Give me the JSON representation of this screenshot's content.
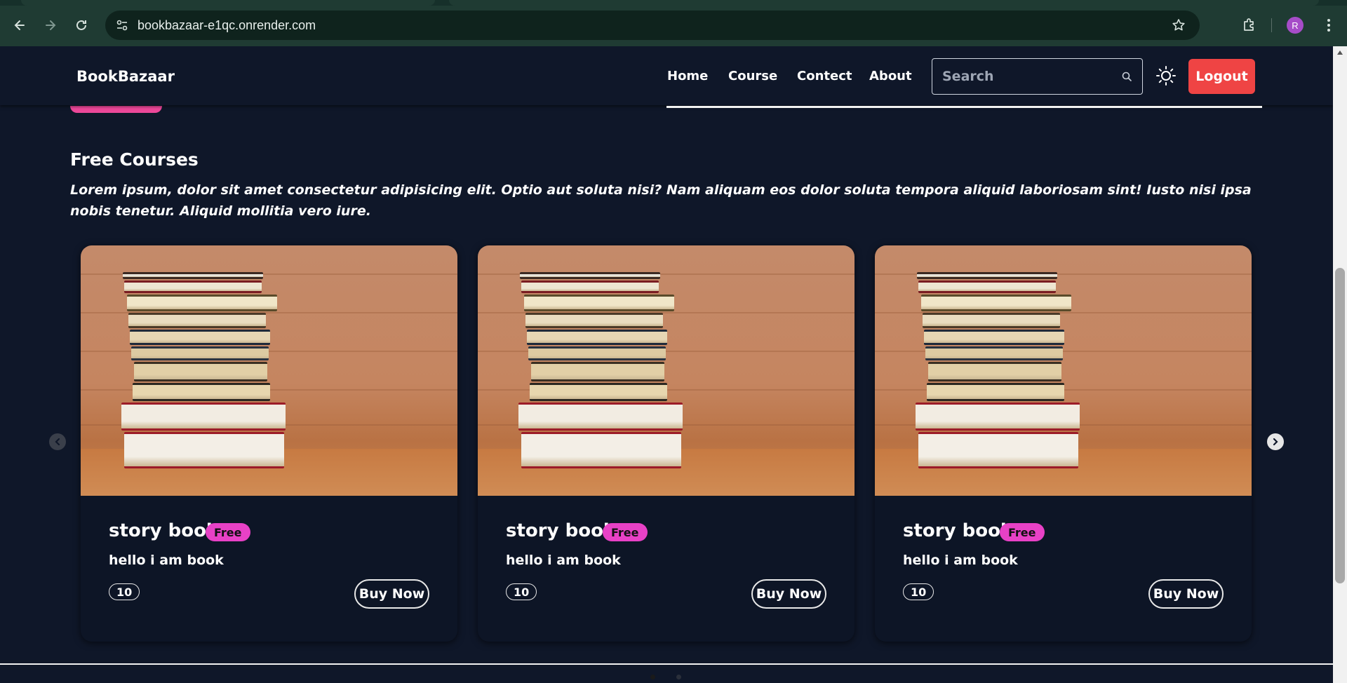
{
  "browser": {
    "url": "bookbazaar-e1qc.onrender.com",
    "profile_initial": "R",
    "icons": [
      "back-icon",
      "forward-icon",
      "reload-icon",
      "site-settings-icon",
      "bookmark-star-icon",
      "extensions-icon",
      "kebab-menu-icon"
    ]
  },
  "header": {
    "brand": "BookBazaar",
    "nav": [
      "Home",
      "Course",
      "Contect",
      "About"
    ],
    "search_placeholder": "Search",
    "logout_label": "Logout",
    "colors": {
      "logout": "#ef4444",
      "accent": "#ec4899",
      "background": "#0f1729"
    }
  },
  "section": {
    "title": "Free Courses",
    "description": "Lorem ipsum, dolor sit amet consectetur adipisicing elit. Optio aut soluta nisi? Nam aliquam eos dolor soluta tempora aliquid laboriosam sint! Iusto nisi ipsa nobis tenetur. Aliquid mollitia vero iure."
  },
  "cards": [
    {
      "title": "story book",
      "badge": "Free",
      "description": "hello i am book",
      "price": "10",
      "button": "Buy Now"
    },
    {
      "title": "story book",
      "badge": "Free",
      "description": "hello i am book",
      "price": "10",
      "button": "Buy Now"
    },
    {
      "title": "story book",
      "badge": "Free",
      "description": "hello i am book",
      "price": "10",
      "button": "Buy Now"
    }
  ],
  "slider": {
    "dots_count": 2,
    "active_dot": 0
  }
}
